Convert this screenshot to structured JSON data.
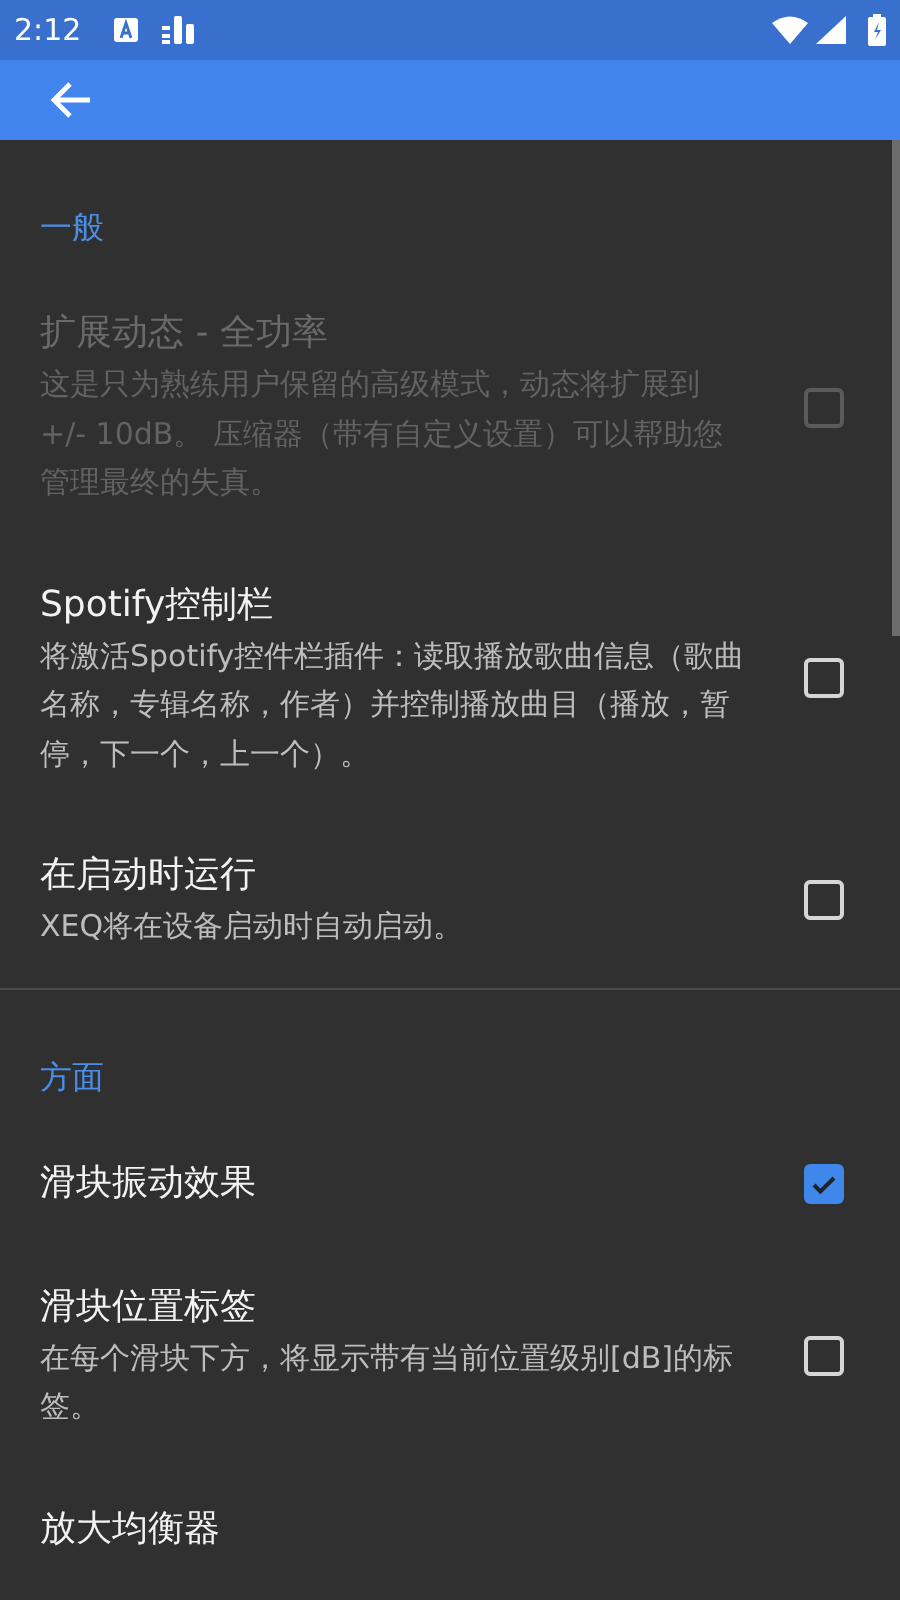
{
  "status_bar": {
    "time": "2:12"
  },
  "sections": [
    {
      "title": "一般",
      "items": [
        {
          "title": "扩展动态 - 全功率",
          "description": "这是只为熟练用户保留的高级模式，动态将扩展到 +/- 10dB。 压缩器（带有自定义设置）可以帮助您管理最终的失真。",
          "checked": false,
          "disabled": true
        },
        {
          "title": "Spotify控制栏",
          "description": "将激活Spotify控件栏插件：读取播放歌曲信息（歌曲名称，专辑名称，作者）并控制播放曲目（播放，暂停，下一个，上一个）。",
          "checked": false,
          "disabled": false
        },
        {
          "title": "在启动时运行",
          "description": "XEQ将在设备启动时自动启动。",
          "checked": false,
          "disabled": false
        }
      ]
    },
    {
      "title": "方面",
      "items": [
        {
          "title": "滑块振动效果",
          "checked": true,
          "disabled": false
        },
        {
          "title": "滑块位置标签",
          "description": "在每个滑块下方，将显示带有当前位置级别[dB]的标签。",
          "checked": false,
          "disabled": false
        },
        {
          "title": "放大均衡器",
          "disabled": false
        }
      ]
    }
  ]
}
